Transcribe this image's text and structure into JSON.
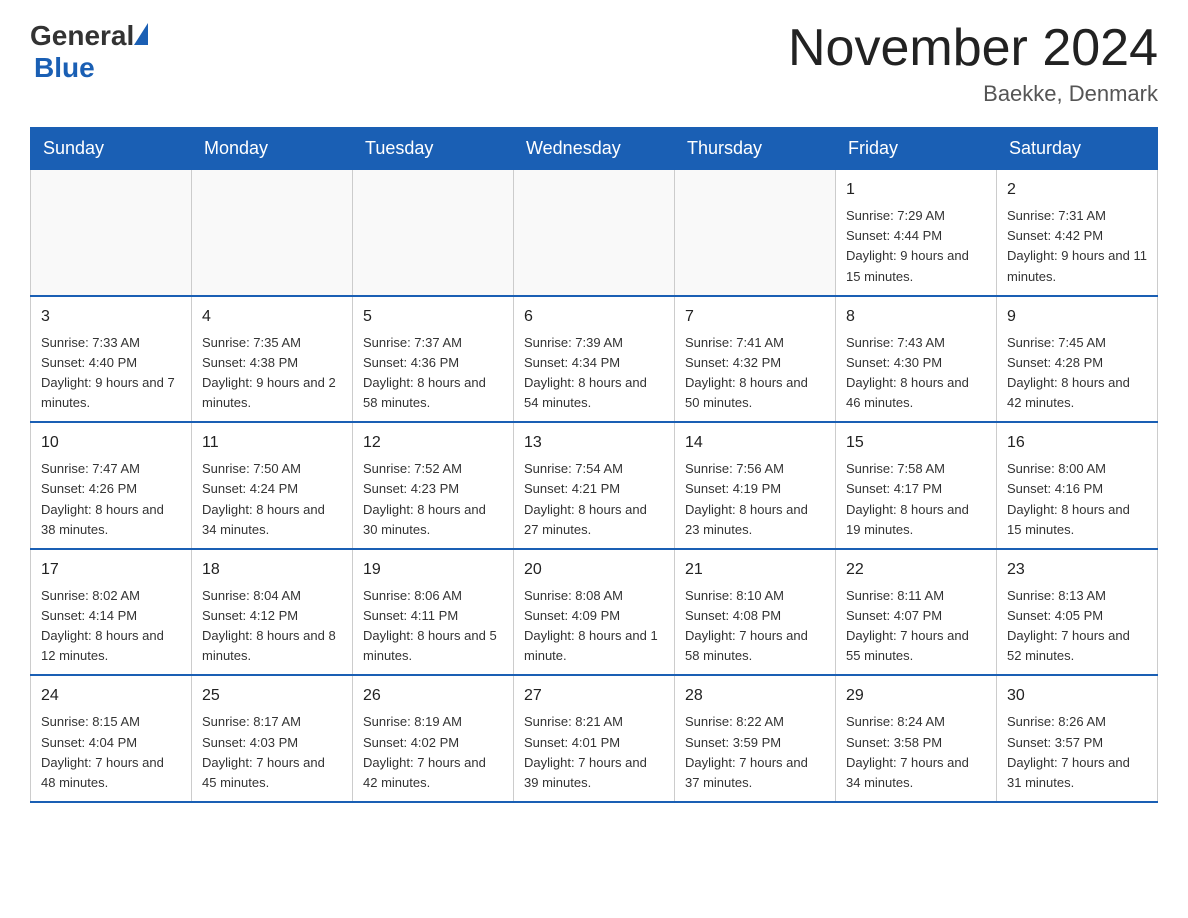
{
  "logo": {
    "text_general": "General",
    "text_blue": "Blue"
  },
  "header": {
    "title": "November 2024",
    "subtitle": "Baekke, Denmark"
  },
  "weekdays": [
    "Sunday",
    "Monday",
    "Tuesday",
    "Wednesday",
    "Thursday",
    "Friday",
    "Saturday"
  ],
  "weeks": [
    [
      {
        "day": "",
        "info": ""
      },
      {
        "day": "",
        "info": ""
      },
      {
        "day": "",
        "info": ""
      },
      {
        "day": "",
        "info": ""
      },
      {
        "day": "",
        "info": ""
      },
      {
        "day": "1",
        "info": "Sunrise: 7:29 AM\nSunset: 4:44 PM\nDaylight: 9 hours and 15 minutes."
      },
      {
        "day": "2",
        "info": "Sunrise: 7:31 AM\nSunset: 4:42 PM\nDaylight: 9 hours and 11 minutes."
      }
    ],
    [
      {
        "day": "3",
        "info": "Sunrise: 7:33 AM\nSunset: 4:40 PM\nDaylight: 9 hours and 7 minutes."
      },
      {
        "day": "4",
        "info": "Sunrise: 7:35 AM\nSunset: 4:38 PM\nDaylight: 9 hours and 2 minutes."
      },
      {
        "day": "5",
        "info": "Sunrise: 7:37 AM\nSunset: 4:36 PM\nDaylight: 8 hours and 58 minutes."
      },
      {
        "day": "6",
        "info": "Sunrise: 7:39 AM\nSunset: 4:34 PM\nDaylight: 8 hours and 54 minutes."
      },
      {
        "day": "7",
        "info": "Sunrise: 7:41 AM\nSunset: 4:32 PM\nDaylight: 8 hours and 50 minutes."
      },
      {
        "day": "8",
        "info": "Sunrise: 7:43 AM\nSunset: 4:30 PM\nDaylight: 8 hours and 46 minutes."
      },
      {
        "day": "9",
        "info": "Sunrise: 7:45 AM\nSunset: 4:28 PM\nDaylight: 8 hours and 42 minutes."
      }
    ],
    [
      {
        "day": "10",
        "info": "Sunrise: 7:47 AM\nSunset: 4:26 PM\nDaylight: 8 hours and 38 minutes."
      },
      {
        "day": "11",
        "info": "Sunrise: 7:50 AM\nSunset: 4:24 PM\nDaylight: 8 hours and 34 minutes."
      },
      {
        "day": "12",
        "info": "Sunrise: 7:52 AM\nSunset: 4:23 PM\nDaylight: 8 hours and 30 minutes."
      },
      {
        "day": "13",
        "info": "Sunrise: 7:54 AM\nSunset: 4:21 PM\nDaylight: 8 hours and 27 minutes."
      },
      {
        "day": "14",
        "info": "Sunrise: 7:56 AM\nSunset: 4:19 PM\nDaylight: 8 hours and 23 minutes."
      },
      {
        "day": "15",
        "info": "Sunrise: 7:58 AM\nSunset: 4:17 PM\nDaylight: 8 hours and 19 minutes."
      },
      {
        "day": "16",
        "info": "Sunrise: 8:00 AM\nSunset: 4:16 PM\nDaylight: 8 hours and 15 minutes."
      }
    ],
    [
      {
        "day": "17",
        "info": "Sunrise: 8:02 AM\nSunset: 4:14 PM\nDaylight: 8 hours and 12 minutes."
      },
      {
        "day": "18",
        "info": "Sunrise: 8:04 AM\nSunset: 4:12 PM\nDaylight: 8 hours and 8 minutes."
      },
      {
        "day": "19",
        "info": "Sunrise: 8:06 AM\nSunset: 4:11 PM\nDaylight: 8 hours and 5 minutes."
      },
      {
        "day": "20",
        "info": "Sunrise: 8:08 AM\nSunset: 4:09 PM\nDaylight: 8 hours and 1 minute."
      },
      {
        "day": "21",
        "info": "Sunrise: 8:10 AM\nSunset: 4:08 PM\nDaylight: 7 hours and 58 minutes."
      },
      {
        "day": "22",
        "info": "Sunrise: 8:11 AM\nSunset: 4:07 PM\nDaylight: 7 hours and 55 minutes."
      },
      {
        "day": "23",
        "info": "Sunrise: 8:13 AM\nSunset: 4:05 PM\nDaylight: 7 hours and 52 minutes."
      }
    ],
    [
      {
        "day": "24",
        "info": "Sunrise: 8:15 AM\nSunset: 4:04 PM\nDaylight: 7 hours and 48 minutes."
      },
      {
        "day": "25",
        "info": "Sunrise: 8:17 AM\nSunset: 4:03 PM\nDaylight: 7 hours and 45 minutes."
      },
      {
        "day": "26",
        "info": "Sunrise: 8:19 AM\nSunset: 4:02 PM\nDaylight: 7 hours and 42 minutes."
      },
      {
        "day": "27",
        "info": "Sunrise: 8:21 AM\nSunset: 4:01 PM\nDaylight: 7 hours and 39 minutes."
      },
      {
        "day": "28",
        "info": "Sunrise: 8:22 AM\nSunset: 3:59 PM\nDaylight: 7 hours and 37 minutes."
      },
      {
        "day": "29",
        "info": "Sunrise: 8:24 AM\nSunset: 3:58 PM\nDaylight: 7 hours and 34 minutes."
      },
      {
        "day": "30",
        "info": "Sunrise: 8:26 AM\nSunset: 3:57 PM\nDaylight: 7 hours and 31 minutes."
      }
    ]
  ]
}
